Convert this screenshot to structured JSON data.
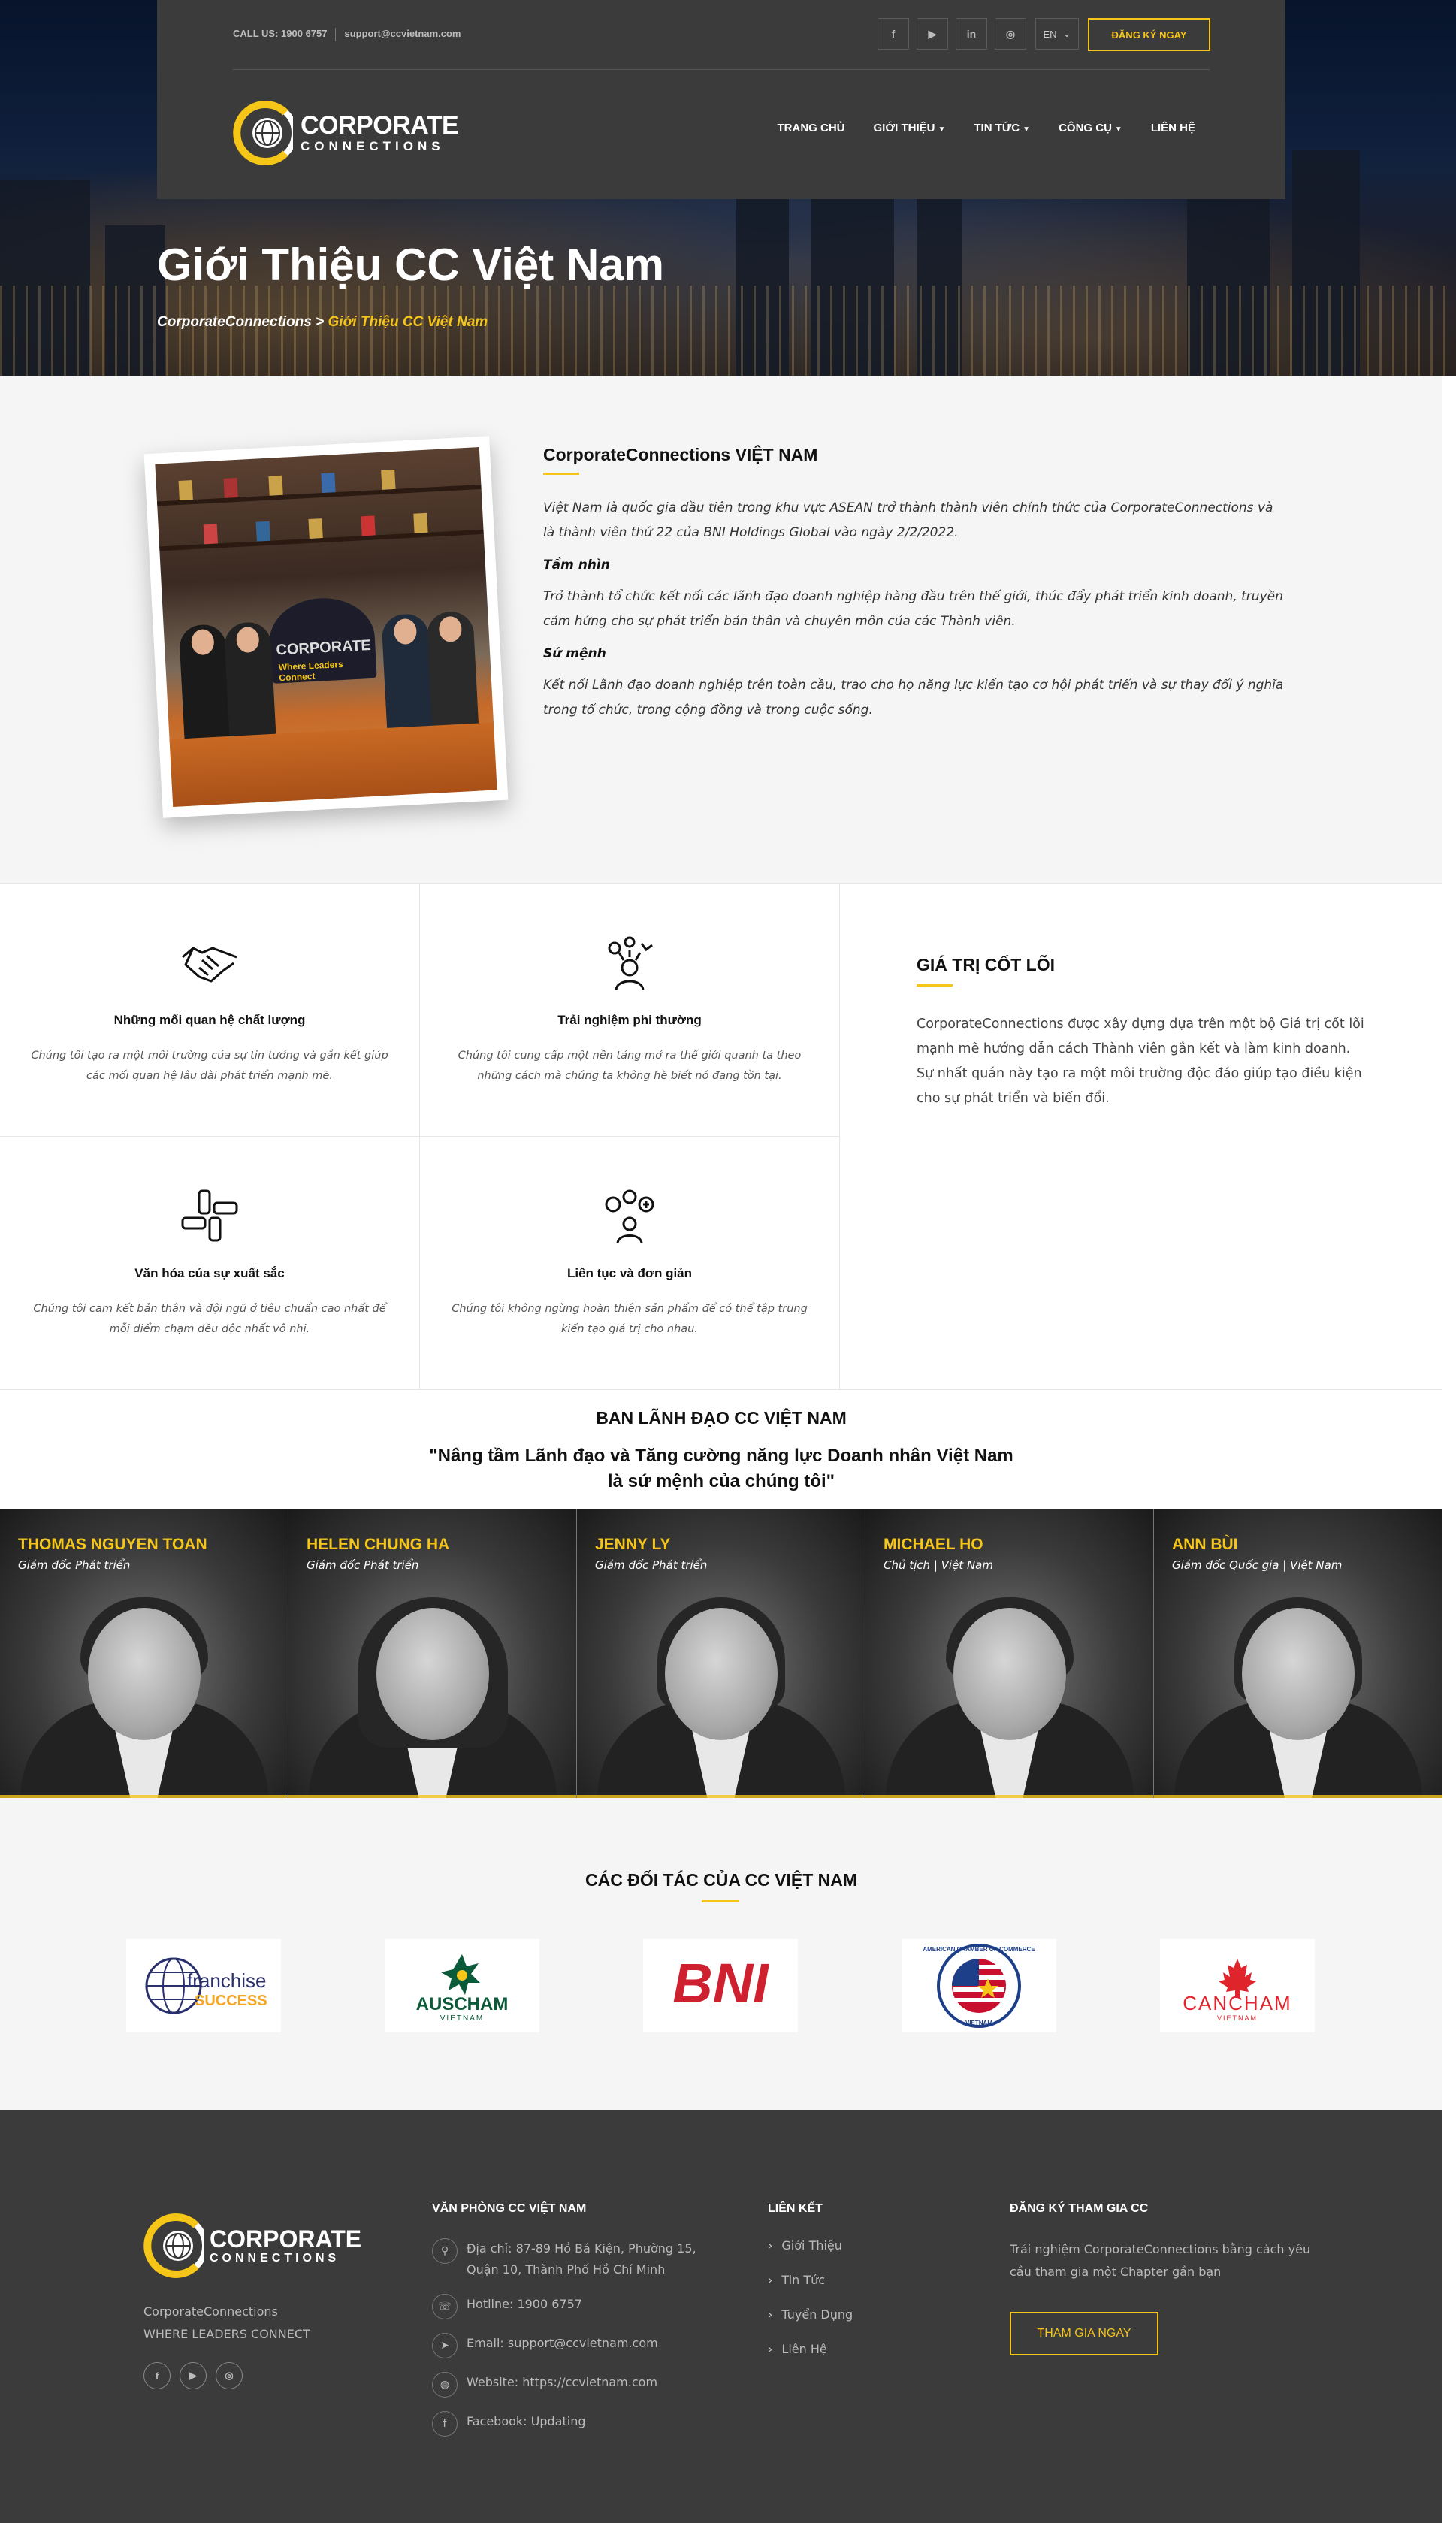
{
  "header": {
    "phone": "CALL US: 1900 6757",
    "email": "support@ccvietnam.com",
    "social": [
      "f",
      "▶",
      "in",
      "◎"
    ],
    "social_icons": [
      "facebook-icon",
      "youtube-icon",
      "linkedin-icon",
      "instagram-icon"
    ],
    "lang": "EN",
    "register_label": "ĐĂNG KÝ NGAY",
    "logo_line1": "CORPORATE",
    "logo_line2": "CONNECTIONS",
    "nav": [
      "TRANG CHỦ",
      "GIỚI THIỆU",
      "TIN TỨC",
      "CÔNG CỤ",
      "LIÊN HỆ"
    ]
  },
  "hero": {
    "title": "Giới Thiệu CC Việt Nam",
    "breadcrumb_root": "CorporateConnections",
    "breadcrumb_sep": " > ",
    "breadcrumb_current": "Giới Thiệu CC Việt Nam"
  },
  "about": {
    "photo_text1": "CORPORATE",
    "photo_text2": "Where Leaders Connect",
    "title": "CorporateConnections VIỆT NAM",
    "intro": "Việt Nam là quốc gia đầu tiên trong khu vực ASEAN trở thành thành viên chính thức của CorporateConnections và là thành viên thứ 22 của BNI Holdings Global vào ngày 2/2/2022.",
    "vision_title": "Tầm nhìn",
    "vision": "Trở thành tổ chức kết nối các lãnh đạo doanh nghiệp hàng đầu trên thế giới, thúc đẩy phát triển kinh doanh, truyền cảm hứng cho sự phát triển bản thân và chuyên môn của các Thành viên.",
    "mission_title": "Sứ mệnh",
    "mission": "Kết nối Lãnh đạo doanh nghiệp trên toàn cầu, trao cho họ năng lực kiến tạo cơ hội phát triển và sự thay đổi ý nghĩa trong tổ chức, trong cộng đồng và trong cuộc sống."
  },
  "values": {
    "items": [
      {
        "title": "Những mối quan hệ chất lượng",
        "desc": "Chúng tôi tạo ra một môi trường của sự tin tưởng và gắn kết giúp các mối quan hệ lâu dài phát triển mạnh mẽ.",
        "icon": "handshake-icon"
      },
      {
        "title": "Trải nghiệm phi thường",
        "desc": "Chúng tôi cung cấp một nền tảng mở ra thế giới quanh ta theo những cách mà chúng ta không hề biết nó đang tồn tại.",
        "icon": "person-ideas-icon"
      },
      {
        "title": "Văn hóa của sự xuất sắc",
        "desc": "Chúng tôi cam kết bản thân và đội ngũ ở tiêu chuẩn cao nhất để mỗi điểm chạm đều độc nhất vô nhị.",
        "icon": "teamwork-hands-icon"
      },
      {
        "title": "Liên tục và đơn giản",
        "desc": "Chúng tôi không ngừng hoàn thiện sản phẩm để có thể tập trung kiến tạo giá trị cho nhau.",
        "icon": "gears-person-icon"
      }
    ],
    "core_title": "GIÁ TRỊ CỐT LÕI",
    "core_desc": "CorporateConnections được xây dựng dựa trên một bộ Giá trị cốt lõi mạnh mẽ hướng dẫn cách Thành viên gắn kết và làm kinh doanh. Sự nhất quán này tạo ra một môi trường độc đáo giúp tạo điều kiện cho sự phát triển và biến đổi."
  },
  "leadership": {
    "title": "BAN LÃNH ĐẠO CC VIỆT NAM",
    "slogan1": "\"Nâng tầm Lãnh đạo và Tăng cường năng lực Doanh nhân Việt Nam",
    "slogan2": "là sứ mệnh của chúng tôi\"",
    "people": [
      {
        "name": "THOMAS NGUYEN TOAN",
        "role": "Giám đốc Phát triển"
      },
      {
        "name": "HELEN CHUNG HA",
        "role": "Giám đốc Phát triển"
      },
      {
        "name": "JENNY LY",
        "role": "Giám đốc Phát triển"
      },
      {
        "name": "MICHAEL HO",
        "role": "Chủ tịch | Việt Nam"
      },
      {
        "name": "ANN BÙI",
        "role": "Giám đốc Quốc gia | Việt Nam"
      }
    ]
  },
  "partners": {
    "title": "CÁC ĐỐI TÁC CỦA CC VIỆT NAM",
    "logos": [
      {
        "name": "franchise",
        "sub": "SUCCESS"
      },
      {
        "name": "AUSCHAM",
        "sub": "VIETNAM"
      },
      {
        "name": "BNI",
        "sub": ""
      },
      {
        "name": "AMERICAN CHAMBER OF COMMERCE",
        "sub": "VIETNAM"
      },
      {
        "name": "CANCHAM",
        "sub": "VIETNAM"
      }
    ]
  },
  "footer": {
    "logo_line1": "CORPORATE",
    "logo_line2": "CONNECTIONS",
    "tag1": "CorporateConnections",
    "tag2": "WHERE LEADERS CONNECT",
    "office_title": "VĂN PHÒNG CC VIỆT NAM",
    "address1": "Địa chỉ: 87-89 Hồ Bá Kiện, Phường 15,",
    "address2": "Quận 10, Thành Phố Hồ Chí Minh",
    "hotline": "Hotline: 1900 6757",
    "email": "Email: support@ccvietnam.com",
    "website": "Website: https://ccvietnam.com",
    "facebook": "Facebook: Updating",
    "links_title": "LIÊN KẾT",
    "links": [
      "Giới Thiệu",
      "Tin Tức",
      "Tuyển Dụng",
      "Liên Hệ"
    ],
    "reg_title": "ĐĂNG KÝ THAM GIA CC",
    "reg_desc": "Trải nghiệm CorporateConnections bằng cách yêu cầu tham gia một Chapter gần bạn",
    "reg_button": "THAM GIA NGAY"
  },
  "colors": {
    "accent": "#f5c518",
    "dark": "#3b3b3b",
    "light_bg": "#f5f5f5"
  }
}
